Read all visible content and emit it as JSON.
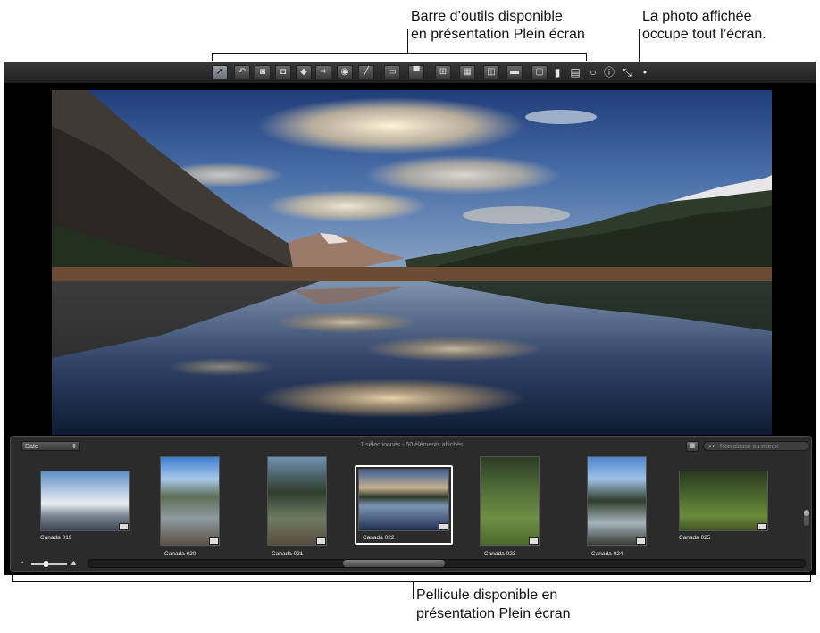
{
  "callouts": {
    "toolbar_line1": "Barre d’outils disponible",
    "toolbar_line2": "en présentation Plein écran",
    "photo_line1": "La photo affichée",
    "photo_line2": "occupe tout l’écran.",
    "strip_line1": "Pellicule disponible en",
    "strip_line2": "présentation Plein écran"
  },
  "toolbar": {
    "tools": [
      "pointer-icon",
      "rotate-icon",
      "photo-stack-icon",
      "photo-stack-alt-icon",
      "tag-icon",
      "crop-icon",
      "red-eye-icon",
      "brush-icon",
      "viewer-icon",
      "split-icon",
      "compare-icon",
      "single-icon",
      "two-up-icon",
      "multi-icon",
      "film-icon",
      "loupe-icon",
      "layers-icon",
      "circle-icon",
      "info-icon",
      "exit-fullscreen-icon",
      "lamp-icon"
    ]
  },
  "filmstrip": {
    "sort_value": "Date",
    "status_text": "1 sélectionnés - 50 éléments affichés",
    "search_placeholder": "Non classé ou mieux",
    "thumbnails": [
      {
        "caption": "Canada 019",
        "selected": false
      },
      {
        "caption": "Canada 020",
        "selected": false
      },
      {
        "caption": "Canada 021",
        "selected": false
      },
      {
        "caption": "Canada 022",
        "selected": true
      },
      {
        "caption": "Canada 023",
        "selected": false
      },
      {
        "caption": "Canada 024",
        "selected": false
      },
      {
        "caption": "Canada 025",
        "selected": false
      }
    ]
  }
}
